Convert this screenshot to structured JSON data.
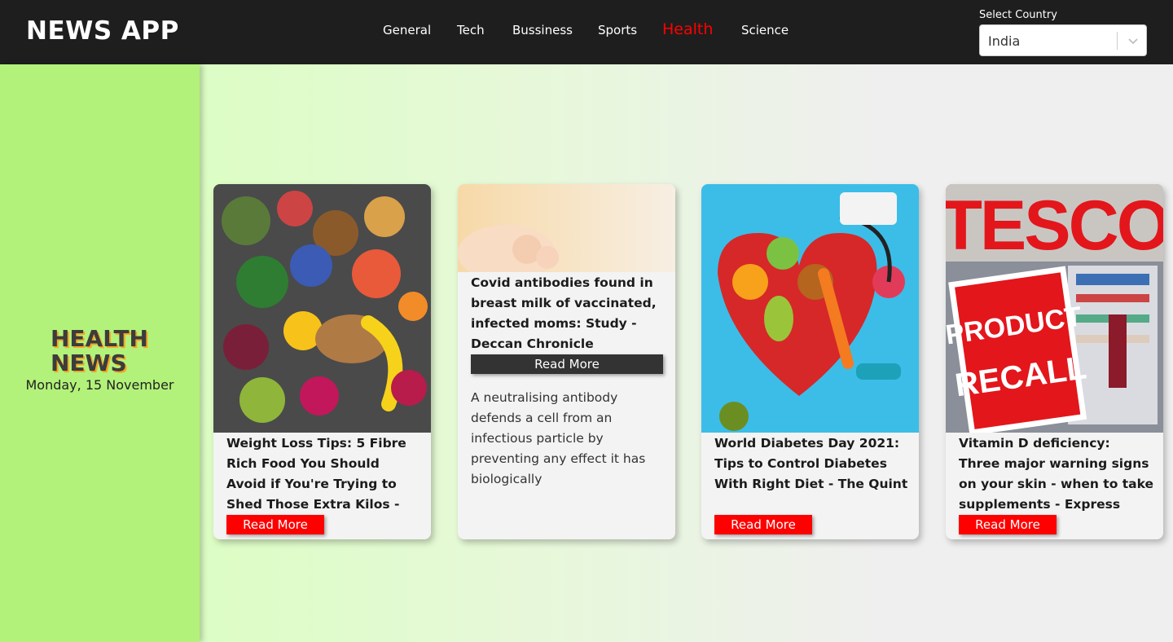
{
  "header": {
    "brand": "NEWS APP",
    "nav": [
      {
        "label": "General",
        "active": false
      },
      {
        "label": "Tech",
        "active": false
      },
      {
        "label": "Bussiness",
        "active": false
      },
      {
        "label": "Sports",
        "active": false
      },
      {
        "label": "Health",
        "active": true
      },
      {
        "label": "Science",
        "active": false
      }
    ],
    "country_label": "Select Country",
    "country_value": "India"
  },
  "sidebar": {
    "title_line1": "HEALTH",
    "title_line2": "NEWS",
    "date": "Monday, 15 November"
  },
  "cards": [
    {
      "title": "Weight Loss Tips: 5 Fibre Rich Food You Should Avoid if You're Trying to Shed Those Extra Kilos -",
      "read_more": "Read More",
      "image": "vegetables-fruits-grains-photo"
    },
    {
      "title": "Covid antibodies found in breast milk of vaccinated, infected moms: Study - Deccan Chronicle",
      "read_more": "Read More",
      "description": "A neutralising antibody defends a cell from an infectious particle by preventing any effect it has biologically",
      "image": "baby-hand-photo"
    },
    {
      "title": "World Diabetes Day 2021: Tips to Control Diabetes With Right Diet - The Quint",
      "read_more": "Read More",
      "image": "heart-bowl-stethoscope-photo"
    },
    {
      "title": "Vitamin D deficiency: Three major warning signs on your skin - when to take supplements - Express",
      "read_more": "Read More",
      "image": "tesco-product-recall-photo",
      "image_text": {
        "store": "TESCO",
        "stamp_line1": "PRODUCT",
        "stamp_line2": "RECALL"
      }
    }
  ],
  "colors": {
    "header_bg": "#1e1e1e",
    "active_nav": "#ff0000",
    "sidebar_bg": "#b3f27a",
    "read_more_bg": "#ff0000",
    "read_more_active_bg": "#333333"
  }
}
